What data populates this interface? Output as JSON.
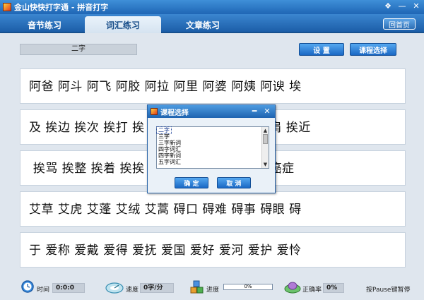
{
  "window": {
    "title": "金山快快打字通 - 拼音打字",
    "minimize_glyph": "—",
    "close_glyph": "✕",
    "skin_glyph": "❖"
  },
  "tabs": [
    {
      "label": "音节练习"
    },
    {
      "label": "词汇练习",
      "active": true
    },
    {
      "label": "文章练习"
    }
  ],
  "home_button": "回首页",
  "lesson_name": "二字",
  "settings_button": "设  置",
  "course_button": "课程选择",
  "rows": [
    "阿爸 阿斗 阿飞 阿胶 阿拉 阿里 阿婆 阿姨 阿谀 埃",
    "及 挨边 挨次 挨打 挨                           挨肩 挨近",
    " 挨骂 挨整 挨着 挨挨                          病 癌症",
    "艾草 艾虎 艾蓬 艾绒 艾蒿 碍口 碍难 碍事 碍眼 碍",
    "于 爱称 爱戴 爱得 爱抚 爱国 爱好 爱河 爱护 爱怜"
  ],
  "dialog": {
    "title": "课程选择",
    "minimize_glyph": "━",
    "close_glyph": "✕",
    "items": [
      "二字",
      "三字",
      "三字新词",
      "四字词汇",
      "四字新词",
      "五字词汇"
    ],
    "selected_index": 0,
    "ok_button": "确  定",
    "cancel_button": "取  消"
  },
  "status": {
    "time_label": "时间",
    "time_value": "0:0:0",
    "speed_label": "速度",
    "speed_value": "0字/分",
    "progress_label": "进度",
    "progress_value": "0%",
    "progress_fraction": 0,
    "accuracy_label": "正确率",
    "accuracy_value": "0%",
    "pause_hint": "按Pause键暂停"
  }
}
